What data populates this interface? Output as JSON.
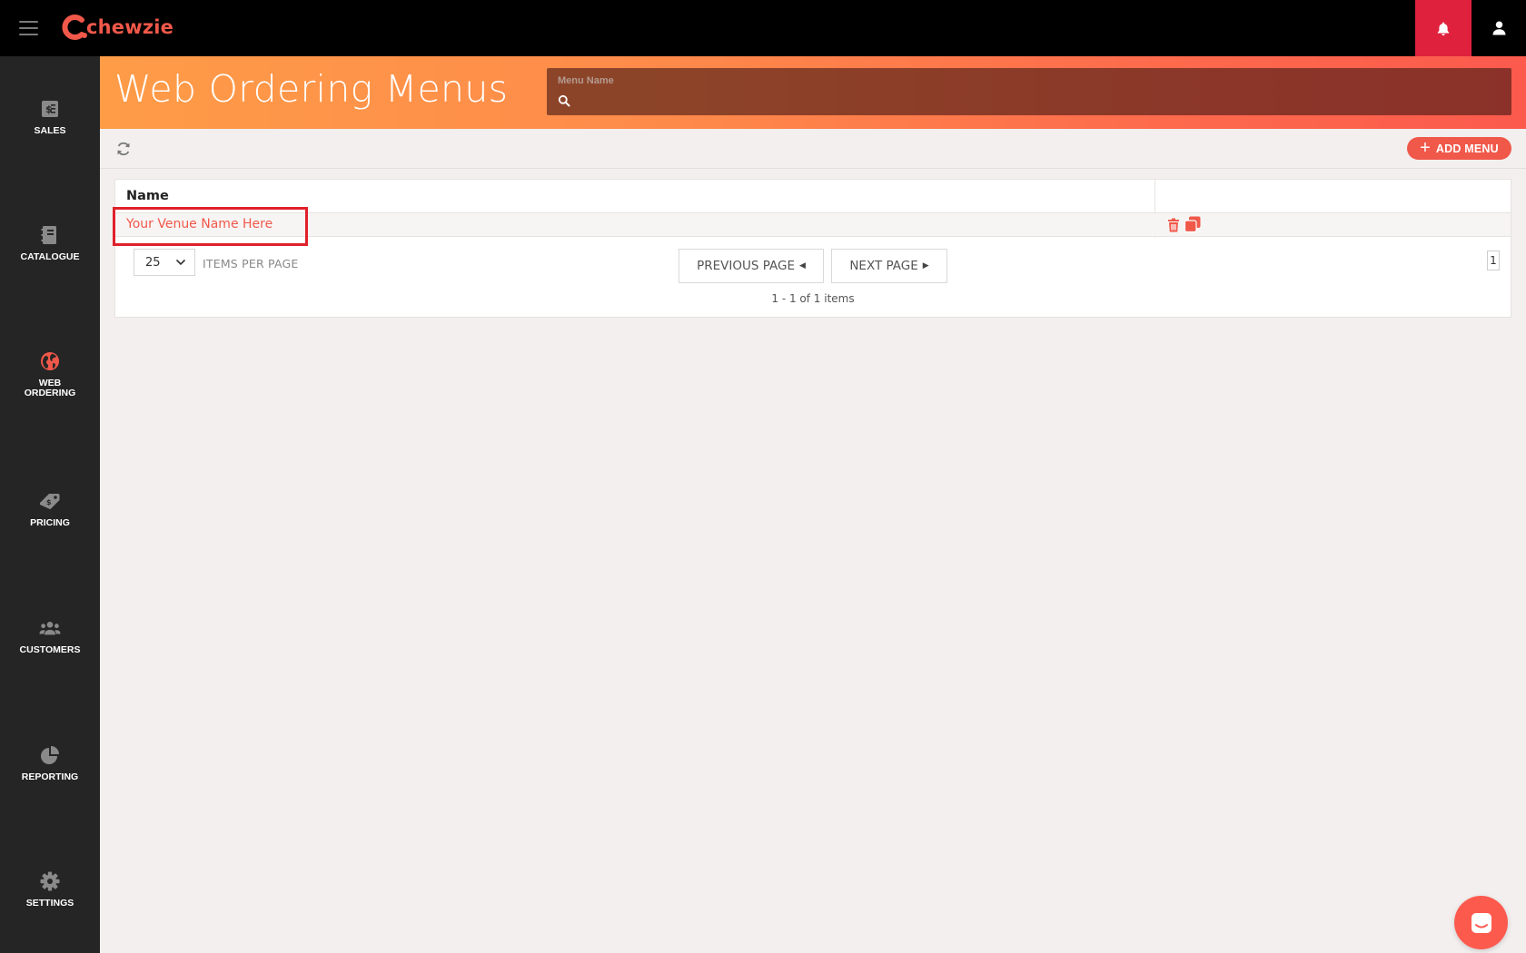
{
  "app": {
    "logo_text": "chewzie",
    "brand_color": "#f0584a",
    "alert_color": "#e0213e"
  },
  "sidebar": {
    "items": [
      {
        "label": "SALES",
        "icon": "sales-receipt-icon",
        "active": false
      },
      {
        "label": "CATALOGUE",
        "icon": "catalogue-book-icon",
        "active": false
      },
      {
        "label": "WEB ORDERING",
        "icon": "globe-icon",
        "active": true
      },
      {
        "label": "PRICING",
        "icon": "price-tag-icon",
        "active": false
      },
      {
        "label": "CUSTOMERS",
        "icon": "customers-group-icon",
        "active": false
      },
      {
        "label": "REPORTING",
        "icon": "pie-chart-icon",
        "active": false
      },
      {
        "label": "SETTINGS",
        "icon": "gear-icon",
        "active": false
      }
    ]
  },
  "header": {
    "title": "Web Ordering Menus",
    "search": {
      "label": "Menu Name",
      "value": "",
      "placeholder": ""
    }
  },
  "toolbar": {
    "add_label": "ADD MENU"
  },
  "grid": {
    "columns": [
      "Name",
      ""
    ],
    "rows": [
      {
        "name": "Your Venue Name Here",
        "actions": [
          "trash-icon",
          "copy-icon"
        ]
      }
    ]
  },
  "pager": {
    "page_size": "25",
    "items_per_page_label": "ITEMS PER PAGE",
    "prev_label": "PREVIOUS PAGE",
    "next_label": "NEXT PAGE",
    "range_text": "1 - 1 of 1 items",
    "current_page": "1"
  }
}
